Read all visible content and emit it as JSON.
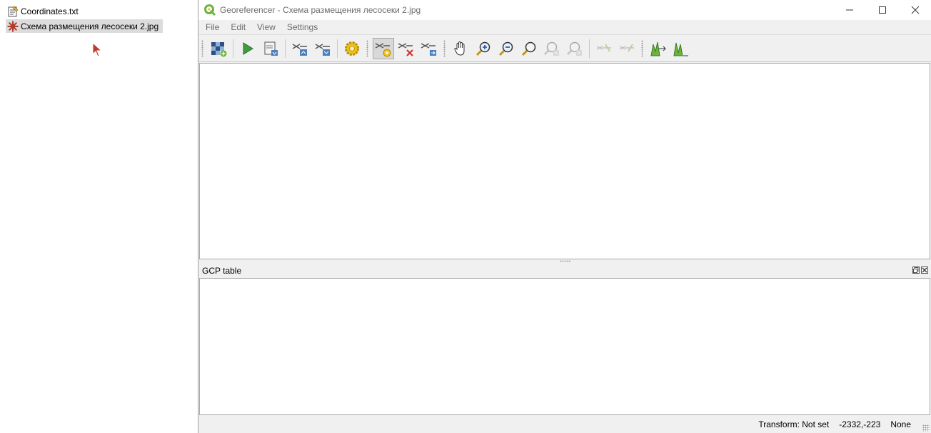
{
  "desktop": {
    "files": [
      {
        "name": "Coordinates.txt",
        "icon": "text-file-icon"
      },
      {
        "name": "Схема размещения лесосеки 2.jpg",
        "icon": "image-file-icon"
      }
    ]
  },
  "window": {
    "title": "Georeferencer - Схема размещения лесосеки 2.jpg",
    "menu": [
      "File",
      "Edit",
      "View",
      "Settings"
    ],
    "toolbar": [
      {
        "name": "open-raster-icon"
      },
      {
        "name": "start-georeferencing-icon"
      },
      {
        "name": "generate-gdal-script-icon"
      },
      {
        "name": "load-gcp-points-icon"
      },
      {
        "name": "save-gcp-points-icon"
      },
      {
        "name": "transformation-settings-icon"
      },
      {
        "name": "add-point-icon"
      },
      {
        "name": "delete-point-icon"
      },
      {
        "name": "move-gcp-point-icon"
      },
      {
        "name": "pan-icon"
      },
      {
        "name": "zoom-in-icon"
      },
      {
        "name": "zoom-out-icon"
      },
      {
        "name": "zoom-to-layer-icon"
      },
      {
        "name": "zoom-last-icon"
      },
      {
        "name": "zoom-next-icon"
      },
      {
        "name": "link-georeferencer-to-qgis-icon"
      },
      {
        "name": "link-qgis-to-georeferencer-icon"
      },
      {
        "name": "full-histogram-stretch-icon"
      },
      {
        "name": "local-histogram-stretch-icon"
      }
    ],
    "gcp_panel_title": "GCP table",
    "status": {
      "transform": "Transform: Not set",
      "coords": "-2332,-223",
      "crs": "None"
    }
  },
  "colors": {
    "accent_green": "#6cb33f",
    "title_grey": "#6d6d6d",
    "cursor_red": "#c0392b"
  }
}
